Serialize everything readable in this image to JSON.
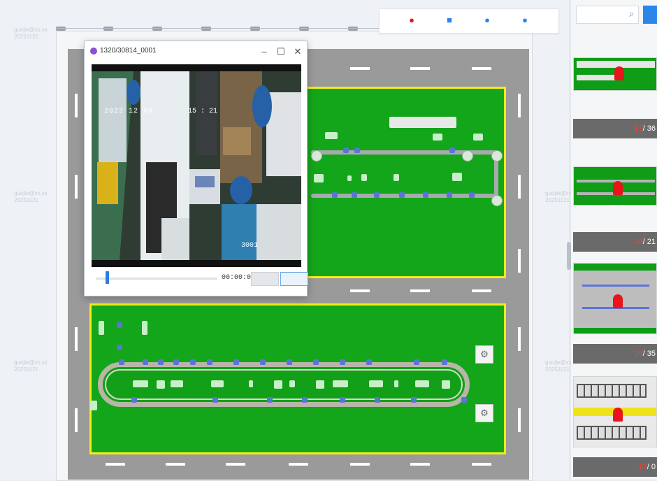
{
  "toolbar": {
    "icons": [
      "red-pin-icon",
      "camera-icon",
      "blue-pin-icon",
      "user-icon"
    ]
  },
  "video_window": {
    "title": "1320/30814_0001",
    "controls": [
      "minimize",
      "maximize",
      "close"
    ],
    "overlay_timestamp": "2022 12 04",
    "overlay_time": "15 : 21",
    "overlay_label": "3001",
    "playback_time": "00:00:01",
    "progress": 0.08
  },
  "watermark": {
    "line1": "guojie@xx.xx",
    "line2": "20251121"
  },
  "side_panel": {
    "search_placeholder": "",
    "cards": [
      {
        "alarm_count": "17",
        "total": "/ 36"
      },
      {
        "alarm_count": "48",
        "total": "/ 21"
      },
      {
        "alarm_count": "29",
        "total": "/ 35"
      },
      {
        "alarm_count": "17",
        "total": "/ 0"
      }
    ]
  },
  "colors": {
    "zone_green": "#13a51a",
    "zone_border": "#f2ee19",
    "alarm_red": "#e8151b",
    "accent_blue": "#2b86ea"
  }
}
